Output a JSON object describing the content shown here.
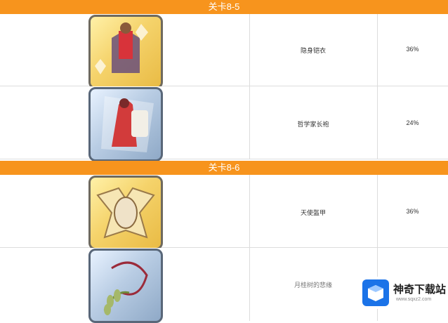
{
  "sections": [
    {
      "stage_label": "关卡8-5",
      "items": [
        {
          "name": "隐身铠衣",
          "drop_rate": "36%",
          "frame": "gold",
          "icon": "armor-robe-icon"
        },
        {
          "name": "哲学家长袍",
          "drop_rate": "24%",
          "frame": "silver",
          "icon": "red-robe-icon"
        }
      ]
    },
    {
      "stage_label": "关卡8-6",
      "items": [
        {
          "name": "天使盔甲",
          "drop_rate": "36%",
          "frame": "gold",
          "icon": "angel-armor-icon"
        },
        {
          "name": "月桂树的悲缘",
          "drop_rate": "",
          "frame": "silver",
          "icon": "laurel-necklace-icon"
        }
      ]
    }
  ],
  "watermark": {
    "brand": "神奇下载站",
    "url": "www.sqxz2.com"
  },
  "colors": {
    "stage_bar": "#f7941d",
    "grid": "#dcdcdc",
    "gold_frame": "#f5d36b",
    "silver_frame": "#b9cde4",
    "logo": "#1b73e8"
  }
}
